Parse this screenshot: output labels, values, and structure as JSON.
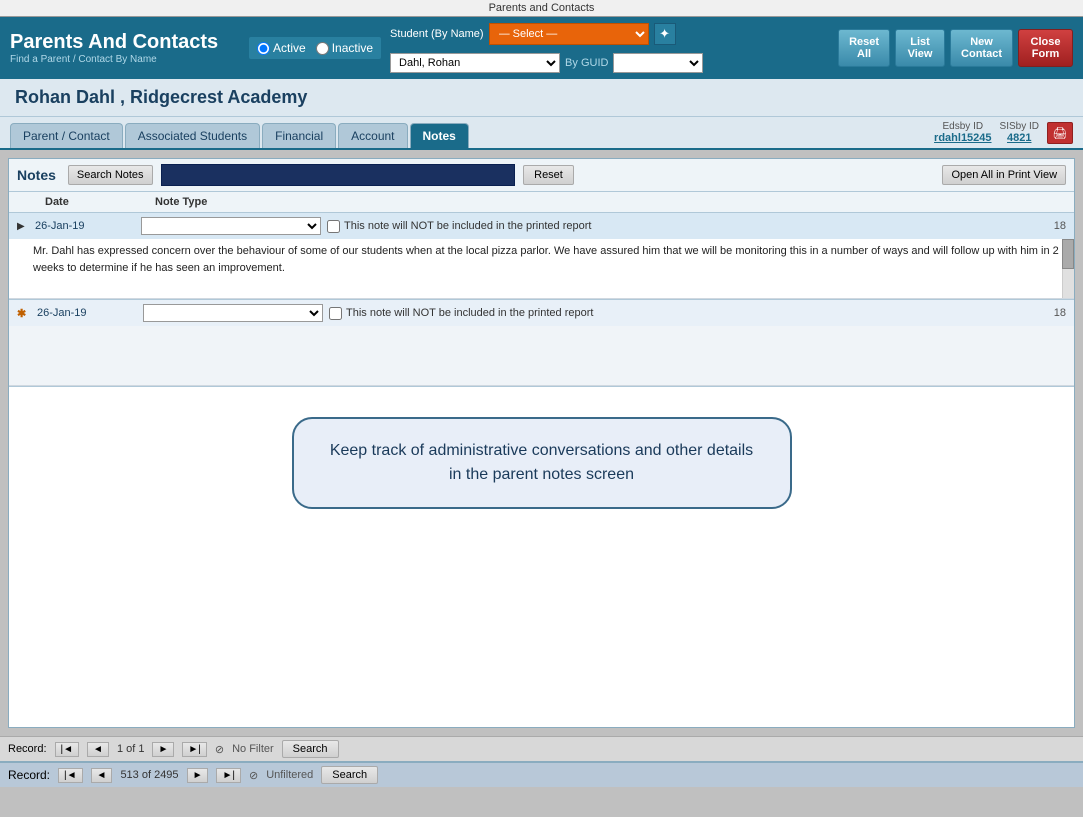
{
  "window": {
    "title": "Parents and Contacts"
  },
  "header": {
    "title": "Parents And Contacts",
    "subtitle": "Find a Parent / Contact By Name",
    "active_label": "Active",
    "inactive_label": "Inactive",
    "student_label": "Student (By Name)",
    "by_guid_label": "By GUID",
    "reset_all_label": "Reset\nAll",
    "list_view_label": "List\nView",
    "new_contact_label": "New\nContact",
    "close_form_label": "Close\nForm",
    "find_value": "Dahl, Rohan",
    "star_icon": "✦"
  },
  "person": {
    "name": "Rohan  Dahl , Ridgecrest Academy"
  },
  "tabs": {
    "items": [
      {
        "label": "Parent / Contact"
      },
      {
        "label": "Associated Students"
      },
      {
        "label": "Financial"
      },
      {
        "label": "Account"
      },
      {
        "label": "Notes"
      }
    ],
    "active_index": 4,
    "edsby_label": "Edsby ID",
    "sisby_label": "SISby ID",
    "edsby_value": "rdahl15245",
    "sisby_value": "4821",
    "print_icon": "🖨"
  },
  "notes": {
    "title": "Notes",
    "search_notes_label": "Search Notes",
    "reset_label": "Reset",
    "print_all_label": "Open All in Print View",
    "col_date": "Date",
    "col_note_type": "Note Type",
    "rows": [
      {
        "date": "26-Jan-19",
        "note_type": "",
        "checkbox_label": "This note will NOT be included in the printed report",
        "row_num": "18",
        "text": "Mr. Dahl has expressed concern over the behaviour of some of our students when at the local pizza parlor.  We have assured him that we will be monitoring this in a number of ways and will follow up with him in 2 weeks to determine if he has seen an improvement.",
        "has_scrollbar": true
      },
      {
        "date": "26-Jan-19",
        "note_type": "",
        "checkbox_label": "This note will NOT be included in the printed report",
        "row_num": "18",
        "text": "",
        "has_scrollbar": false,
        "is_new": true
      }
    ],
    "tooltip": "Keep track of administrative conversations and other details in the parent notes screen"
  },
  "inner_bottom": {
    "record_prefix": "Record:",
    "nav_first": "|◄",
    "nav_prev": "◄",
    "nav_next": "►",
    "nav_next_last": "►|",
    "record_info": "1 of 1",
    "filter_label": "No Filter",
    "search_label": "Search"
  },
  "outer_bottom": {
    "record_prefix": "Record:",
    "nav_first": "|◄",
    "nav_prev": "◄",
    "nav_next": "►",
    "nav_next_last": "►|",
    "record_info": "513 of 2495",
    "filter_label": "Unfiltered",
    "search_label": "Search"
  }
}
